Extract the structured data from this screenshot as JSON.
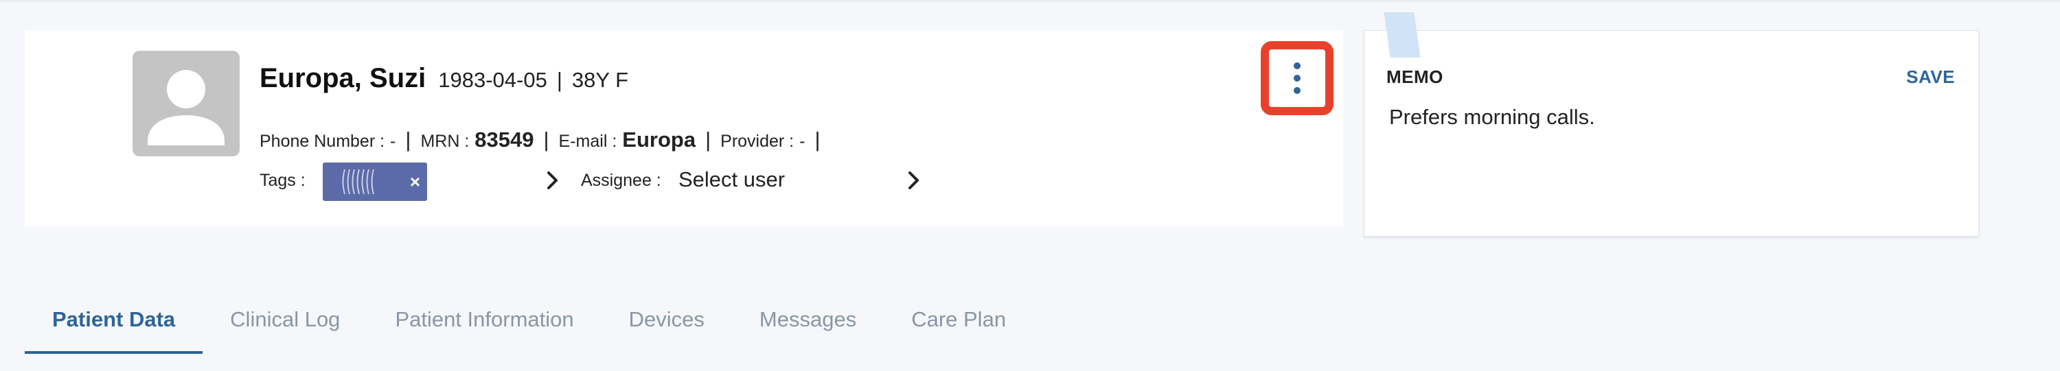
{
  "patient": {
    "name": "Europa, Suzi",
    "dob": "1983-04-05",
    "separator": "|",
    "age_sex": "38Y F",
    "phone_label": "Phone Number :",
    "phone_value": "-",
    "mrn_label": "MRN :",
    "mrn_value": "83549",
    "email_label": "E-mail :",
    "email_value": "Europa",
    "provider_label": "Provider :",
    "provider_value": "-"
  },
  "tags": {
    "label": "Tags :",
    "chip_remove": "×",
    "chip_color": "#5b6aa8"
  },
  "assignee": {
    "label": "Assignee :",
    "value": "Select user"
  },
  "more_menu": {
    "icon": "vertical-ellipsis-icon",
    "highlight_color": "#e8412b"
  },
  "memo": {
    "title": "MEMO",
    "save_label": "SAVE",
    "text": "Prefers morning calls."
  },
  "tabs": [
    {
      "label": "Patient Data",
      "active": true
    },
    {
      "label": "Clinical Log",
      "active": false
    },
    {
      "label": "Patient Information",
      "active": false
    },
    {
      "label": "Devices",
      "active": false
    },
    {
      "label": "Messages",
      "active": false
    },
    {
      "label": "Care Plan",
      "active": false
    }
  ],
  "colors": {
    "accent": "#2f6496",
    "inactive_tab": "#8a95a5",
    "background": "#f5f7fa"
  }
}
